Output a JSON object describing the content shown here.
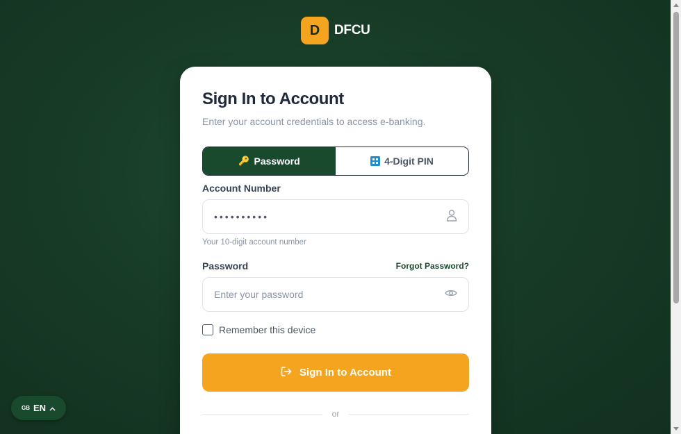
{
  "brand": {
    "initial": "D",
    "name": "DFCU"
  },
  "card": {
    "title": "Sign In to Account",
    "subtitle": "Enter your account credentials to access e-banking."
  },
  "tabs": [
    {
      "label": "Password",
      "icon": "key-icon",
      "active": true
    },
    {
      "label": "4-Digit PIN",
      "icon": "pin-keypad-icon",
      "active": false
    }
  ],
  "account": {
    "label": "Account Number",
    "value": "••••••••••",
    "hint": "Your 10-digit account number"
  },
  "password": {
    "label": "Password",
    "placeholder": "Enter your password",
    "forgot": "Forgot Password?"
  },
  "remember": {
    "label": "Remember this device",
    "checked": false
  },
  "submit": {
    "label": "Sign In to Account"
  },
  "divider": {
    "text": "or"
  },
  "language": {
    "flag": "GB",
    "code": "EN"
  },
  "colors": {
    "primary": "#1a4a2e",
    "accent": "#f4a41e"
  }
}
